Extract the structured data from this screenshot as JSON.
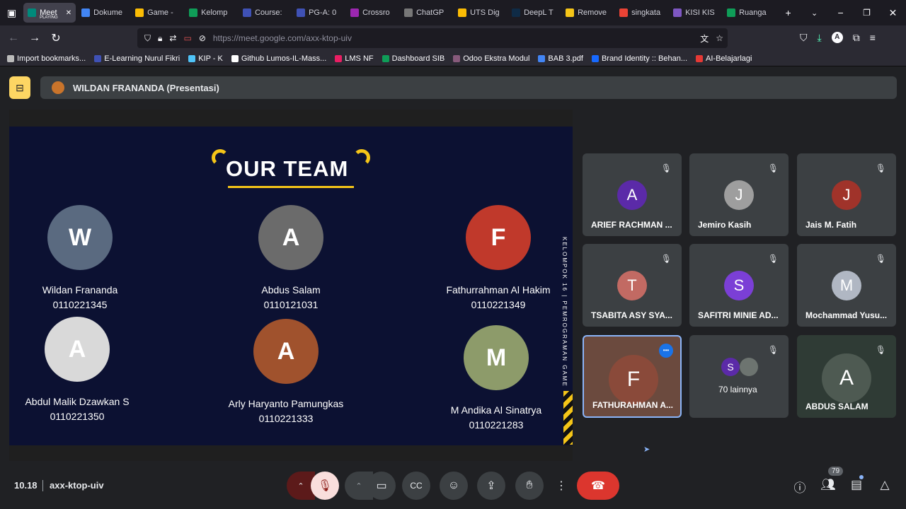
{
  "browser": {
    "tabs": [
      {
        "label": "Meet",
        "sub": "PLAYING",
        "color": "#00897b",
        "active": true
      },
      {
        "label": "Dokume",
        "color": "#4285f4"
      },
      {
        "label": "Game -",
        "color": "#fbbc04"
      },
      {
        "label": "Kelomp",
        "color": "#0f9d58"
      },
      {
        "label": "Course:",
        "color": "#3f51b5"
      },
      {
        "label": "PG-A: 0",
        "color": "#3f51b5"
      },
      {
        "label": "Crossro",
        "color": "#9c27b0"
      },
      {
        "label": "ChatGP",
        "color": "#777777"
      },
      {
        "label": "UTS Dig",
        "color": "#fbbc04"
      },
      {
        "label": "DeepL T",
        "color": "#0f2b46"
      },
      {
        "label": "Remove",
        "color": "#f5c518"
      },
      {
        "label": "singkata",
        "color": "#ea4335"
      },
      {
        "label": "KISI KIS",
        "color": "#7e57c2"
      },
      {
        "label": "Ruanga",
        "color": "#0f9d58"
      }
    ],
    "url": "https://meet.google.com/axx-ktop-uiv",
    "bookmarks": [
      {
        "label": "Import bookmarks...",
        "color": "#bbbbbb"
      },
      {
        "label": "E-Learning Nurul Fikri",
        "color": "#3f51b5"
      },
      {
        "label": "KIP - K",
        "color": "#4fc3f7"
      },
      {
        "label": "Github Lumos-IL-Mass...",
        "color": "#ffffff"
      },
      {
        "label": "LMS NF",
        "color": "#e91e63"
      },
      {
        "label": "Dashboard SIB",
        "color": "#0f9d58"
      },
      {
        "label": "Odoo Ekstra Modul",
        "color": "#875a7b"
      },
      {
        "label": "BAB 3.pdf",
        "color": "#4285f4"
      },
      {
        "label": "Brand Identity :: Behan...",
        "color": "#1769ff"
      },
      {
        "label": "AI-Belajarlagi",
        "color": "#e53935"
      }
    ]
  },
  "meet": {
    "presenter": "WILDAN FRANANDA (Presentasi)",
    "slide": {
      "title": "OUR TEAM",
      "vertical_text": "KELOMPOK 16 | PEMROGRAMAN GAME",
      "members": [
        {
          "name": "Wildan Frananda",
          "nim": "0110221345",
          "initial": "W",
          "color": "#5a6a80"
        },
        {
          "name": "Abdus Salam",
          "nim": "0110121031",
          "initial": "A",
          "color": "#6b6b6b"
        },
        {
          "name": "Fathurrahman Al Hakim",
          "nim": "0110221349",
          "initial": "F",
          "color": "#c0392b"
        },
        {
          "name": "Abdul Malik Dzawkan S",
          "nim": "0110221350",
          "initial": "A",
          "color": "#d9d9d9"
        },
        {
          "name": "Arly Haryanto Pamungkas",
          "nim": "0110221333",
          "initial": "A",
          "color": "#a0522d"
        },
        {
          "name": "M Andika Al Sinatrya",
          "nim": "0110221283",
          "initial": "M",
          "color": "#8d9b6a"
        }
      ]
    },
    "participants": [
      {
        "name": "ARIEF RACHMAN ...",
        "initial": "A",
        "color": "#5b2aa8"
      },
      {
        "name": "Jemiro Kasih",
        "initial": "J",
        "color": "#9e9e9e"
      },
      {
        "name": "Jais M. Fatih",
        "initial": "J",
        "color": "#a0332a"
      },
      {
        "name": "TSABITA ASY SYA...",
        "initial": "T",
        "color": "#c26a63"
      },
      {
        "name": "SAFITRI MINIE AD...",
        "initial": "S",
        "color": "#7b3fd6"
      },
      {
        "name": "Mochammad Yusu...",
        "initial": "M",
        "color": "#b0b7c3"
      },
      {
        "name": "FATHURAHMAN A...",
        "initial": "F",
        "color": "#8a4a3a"
      },
      {
        "name": "70 lainnya",
        "initial": "S",
        "color": "#5b2aa8"
      },
      {
        "name": "ABDUS SALAM",
        "initial": "A",
        "color": "#4e5a52"
      }
    ],
    "time": "10.18",
    "meeting_code": "axx-ktop-uiv",
    "people_count": "79"
  }
}
